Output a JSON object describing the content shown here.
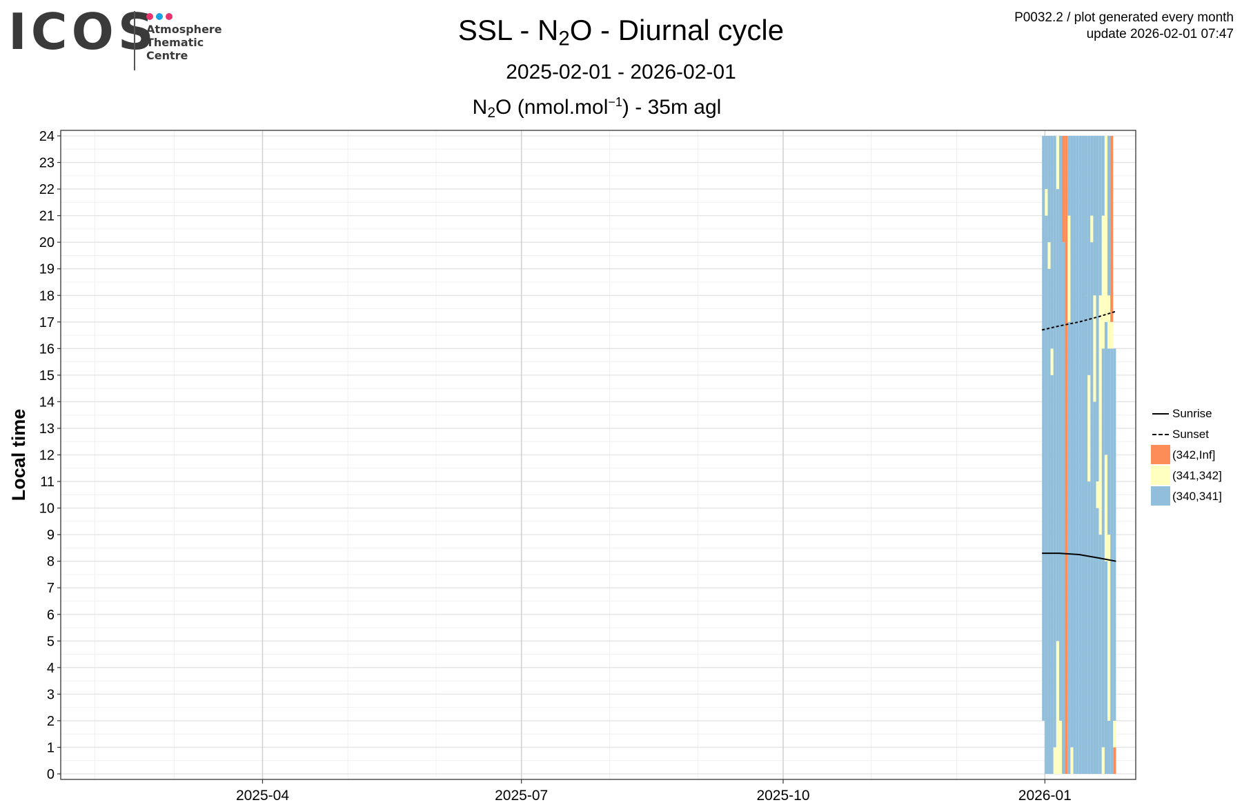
{
  "logo": {
    "wordmark": "ICOS",
    "lines": [
      "Atmosphere",
      "Thematic",
      "Centre"
    ],
    "dot_colors": [
      "#e8336d",
      "#1aa3e0",
      "#e8336d"
    ]
  },
  "header": {
    "title_pre": "SSL - N",
    "title_sub": "2",
    "title_post": "O - Diurnal cycle",
    "date_range": "2025-02-01 - 2026-02-01",
    "subtitle_pre": "N",
    "subtitle_sub": "2",
    "subtitle_mid": "O (nmol.mol",
    "subtitle_sup": "−1",
    "subtitle_post": ") - 35m agl",
    "info_line1": "P0032.2 / plot generated every month",
    "info_line2": "update  2026-02-01 07:47"
  },
  "legend": {
    "sunrise": "Sunrise",
    "sunset": "Sunset",
    "bins": [
      {
        "label": "(342,Inf]",
        "color": "#fc8d59"
      },
      {
        "label": "(341,342]",
        "color": "#ffffbf"
      },
      {
        "label": "(340,341]",
        "color": "#91bfdb"
      }
    ]
  },
  "chart_data": {
    "type": "heatmap",
    "ylabel": "Local time",
    "xlabel": "",
    "x_range": [
      "2025-01-22",
      "2026-01-31"
    ],
    "y_range": [
      0,
      24
    ],
    "x_ticks": [
      "2025-04",
      "2025-07",
      "2025-10",
      "2026-01"
    ],
    "y_ticks": [
      0,
      1,
      2,
      3,
      4,
      5,
      6,
      7,
      8,
      9,
      10,
      11,
      12,
      13,
      14,
      15,
      16,
      17,
      18,
      19,
      20,
      21,
      22,
      23,
      24
    ],
    "grid": true,
    "legend_position": "right",
    "colors": {
      "(342,Inf]": "#fc8d59",
      "(341,342]": "#ffffbf",
      "(340,341]": "#91bfdb"
    },
    "day_columns": [
      {
        "date": "2025-12-31",
        "segments": [
          [
            2,
            24,
            "(340,341]"
          ]
        ]
      },
      {
        "date": "2026-01-01",
        "segments": [
          [
            0,
            21,
            "(340,341]"
          ],
          [
            21,
            22,
            "(341,342]"
          ],
          [
            22,
            24,
            "(340,341]"
          ]
        ]
      },
      {
        "date": "2026-01-02",
        "segments": [
          [
            0,
            19,
            "(340,341]"
          ],
          [
            19,
            20,
            "(341,342]"
          ],
          [
            20,
            24,
            "(340,341]"
          ]
        ]
      },
      {
        "date": "2026-01-03",
        "segments": [
          [
            0,
            15,
            "(340,341]"
          ],
          [
            15,
            16,
            "(341,342]"
          ],
          [
            16,
            24,
            "(340,341]"
          ]
        ]
      },
      {
        "date": "2026-01-04",
        "segments": [
          [
            0,
            1,
            "(341,342]"
          ],
          [
            1,
            24,
            "(340,341]"
          ]
        ]
      },
      {
        "date": "2026-01-05",
        "segments": [
          [
            0,
            5,
            "(341,342]"
          ],
          [
            5,
            22,
            "(340,341]"
          ],
          [
            22,
            24,
            "(341,342]"
          ]
        ]
      },
      {
        "date": "2026-01-06",
        "segments": [
          [
            0,
            2,
            "(341,342]"
          ],
          [
            2,
            24,
            "(340,341]"
          ]
        ]
      },
      {
        "date": "2026-01-07",
        "segments": [
          [
            0,
            20,
            "(340,341]"
          ],
          [
            20,
            24,
            "(342,Inf]"
          ]
        ]
      },
      {
        "date": "2026-01-08",
        "segments": [
          [
            0,
            24,
            "(342,Inf]"
          ]
        ]
      },
      {
        "date": "2026-01-09",
        "segments": [
          [
            0,
            17,
            "(340,341]"
          ],
          [
            17,
            21,
            "(341,342]"
          ],
          [
            21,
            24,
            "(340,341]"
          ]
        ]
      },
      {
        "date": "2026-01-10",
        "segments": [
          [
            0,
            1,
            "(341,342]"
          ],
          [
            1,
            24,
            "(340,341]"
          ]
        ]
      },
      {
        "date": "2026-01-11",
        "segments": [
          [
            0,
            24,
            "(340,341]"
          ]
        ]
      },
      {
        "date": "2026-01-12",
        "segments": [
          [
            0,
            24,
            "(340,341]"
          ]
        ]
      },
      {
        "date": "2026-01-13",
        "segments": [
          [
            0,
            24,
            "(340,341]"
          ]
        ]
      },
      {
        "date": "2026-01-14",
        "segments": [
          [
            0,
            24,
            "(340,341]"
          ]
        ]
      },
      {
        "date": "2026-01-15",
        "segments": [
          [
            0,
            18,
            "(340,341]"
          ],
          [
            18,
            24,
            "(340,341]"
          ]
        ]
      },
      {
        "date": "2026-01-16",
        "segments": [
          [
            0,
            11,
            "(340,341]"
          ],
          [
            11,
            15,
            "(341,342]"
          ],
          [
            15,
            24,
            "(340,341]"
          ]
        ]
      },
      {
        "date": "2026-01-17",
        "segments": [
          [
            0,
            20,
            "(340,341]"
          ],
          [
            20,
            21,
            "(341,342]"
          ],
          [
            21,
            24,
            "(340,341]"
          ]
        ]
      },
      {
        "date": "2026-01-18",
        "segments": [
          [
            0,
            14,
            "(340,341]"
          ],
          [
            14,
            18,
            "(341,342]"
          ],
          [
            18,
            24,
            "(340,341]"
          ]
        ]
      },
      {
        "date": "2026-01-19",
        "segments": [
          [
            0,
            10,
            "(340,341]"
          ],
          [
            10,
            11,
            "(341,342]"
          ],
          [
            11,
            24,
            "(340,341]"
          ]
        ]
      },
      {
        "date": "2026-01-20",
        "segments": [
          [
            0,
            9,
            "(340,341]"
          ],
          [
            9,
            18,
            "(341,342]"
          ],
          [
            18,
            24,
            "(340,341]"
          ]
        ]
      },
      {
        "date": "2026-01-21",
        "segments": [
          [
            0,
            1,
            "(341,342]"
          ],
          [
            1,
            16,
            "(340,341]"
          ],
          [
            16,
            21,
            "(341,342]"
          ],
          [
            21,
            24,
            "(340,341]"
          ]
        ]
      },
      {
        "date": "2026-01-22",
        "segments": [
          [
            0,
            8,
            "(340,341]"
          ],
          [
            8,
            12,
            "(341,342]"
          ],
          [
            12,
            17,
            "(340,341]"
          ],
          [
            17,
            24,
            "(341,342]"
          ]
        ]
      },
      {
        "date": "2026-01-23",
        "segments": [
          [
            0,
            2,
            "(340,341]"
          ],
          [
            2,
            9,
            "(341,342]"
          ],
          [
            9,
            16,
            "(340,341]"
          ],
          [
            16,
            18,
            "(341,342]"
          ],
          [
            18,
            24,
            "(340,341]"
          ]
        ]
      },
      {
        "date": "2026-01-24",
        "segments": [
          [
            0,
            1,
            "(340,341]"
          ],
          [
            1,
            16,
            "(340,341]"
          ],
          [
            16,
            17,
            "(341,342]"
          ],
          [
            17,
            24,
            "(342,Inf]"
          ]
        ]
      },
      {
        "date": "2026-01-25",
        "segments": [
          [
            0,
            1,
            "(342,Inf]"
          ],
          [
            1,
            2,
            "(341,342]"
          ],
          [
            2,
            16,
            "(340,341]"
          ]
        ]
      }
    ],
    "series": [
      {
        "name": "Sunrise",
        "style": "solid",
        "points": [
          [
            "2025-12-31",
            8.3
          ],
          [
            "2026-01-06",
            8.3
          ],
          [
            "2026-01-13",
            8.25
          ],
          [
            "2026-01-20",
            8.12
          ],
          [
            "2026-01-26",
            8.0
          ]
        ]
      },
      {
        "name": "Sunset",
        "style": "dashed",
        "points": [
          [
            "2025-12-31",
            16.7
          ],
          [
            "2026-01-06",
            16.85
          ],
          [
            "2026-01-13",
            17.0
          ],
          [
            "2026-01-20",
            17.2
          ],
          [
            "2026-01-26",
            17.4
          ]
        ]
      }
    ]
  }
}
